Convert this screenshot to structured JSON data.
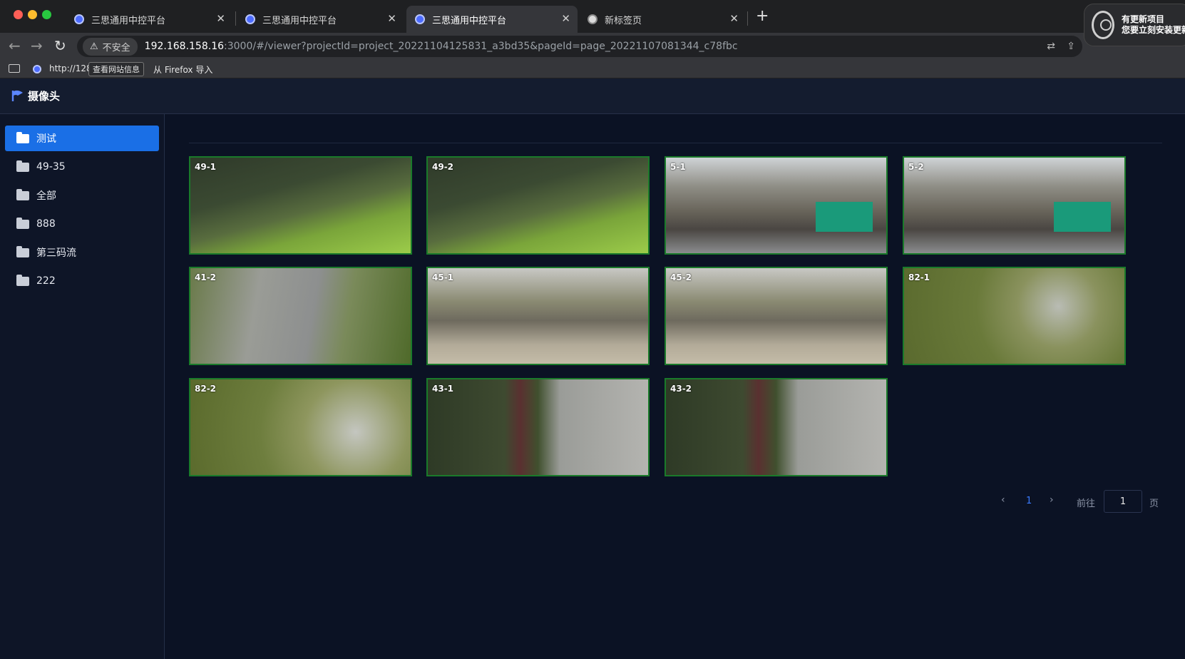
{
  "browser": {
    "tabs": [
      {
        "title": "三思通用中控平台"
      },
      {
        "title": "三思通用中控平台"
      },
      {
        "title": "三思通用中控平台"
      },
      {
        "title": "新标签页"
      }
    ],
    "insecure_label": "不安全",
    "url_host": "192.168.158.16",
    "url_rest": ":3000/#/viewer?projectId=project_20221104125831_a3bd35&pageId=page_20221107081344_c78fbc",
    "bookmarks": {
      "item1": "http://128",
      "item1_tooltip": "查看网站信息",
      "item2": "从 Firefox 导入"
    },
    "update_prompt": {
      "line1": "有更新项目",
      "line2": "您要立刻安装更新"
    }
  },
  "app": {
    "title": "摄像头",
    "sidebar": [
      {
        "label": "测试",
        "active": true
      },
      {
        "label": "49-35"
      },
      {
        "label": "全部"
      },
      {
        "label": "888"
      },
      {
        "label": "第三码流"
      },
      {
        "label": "222"
      }
    ],
    "cameras": [
      {
        "label": "49-1",
        "scene": "garden"
      },
      {
        "label": "49-2",
        "scene": "garden"
      },
      {
        "label": "5-1",
        "scene": "warehouse"
      },
      {
        "label": "5-2",
        "scene": "warehouse"
      },
      {
        "label": "41-2",
        "scene": "road"
      },
      {
        "label": "45-1",
        "scene": "building"
      },
      {
        "label": "45-2",
        "scene": "building"
      },
      {
        "label": "82-1",
        "scene": "tree"
      },
      {
        "label": "82-2",
        "scene": "tree"
      },
      {
        "label": "43-1",
        "scene": "lot"
      },
      {
        "label": "43-2",
        "scene": "lot"
      }
    ],
    "pagination": {
      "current_page": "1",
      "goto_label": "前往",
      "goto_value": "1",
      "page_suffix": "页"
    }
  }
}
